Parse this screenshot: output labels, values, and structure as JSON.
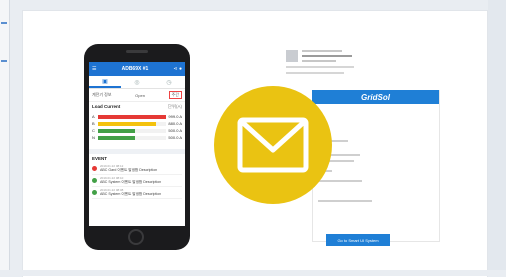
{
  "app": {
    "title": "ADB69X #1",
    "filter_left": "계전기 정보",
    "filter_mid": "Open",
    "filter_right": "주간",
    "load_current_label": "Load Current",
    "load_current_unit": "단위(A)",
    "phases": [
      {
        "label": "A",
        "value": "999.0 A",
        "pct": 1.0,
        "color": "#e53935"
      },
      {
        "label": "B",
        "value": "880.0 A",
        "pct": 0.85,
        "color": "#f4c20d"
      },
      {
        "label": "C",
        "value": "500.0 A",
        "pct": 0.55,
        "color": "#43a047"
      },
      {
        "label": "N",
        "value": "500.0 A",
        "pct": 0.55,
        "color": "#43a047"
      }
    ],
    "event_label": "EVENT",
    "events": [
      {
        "time": "2019.01.22 08:12",
        "text": "ABC Gard 이벤트 발생함 Description",
        "color": "#e53935"
      },
      {
        "time": "2019.01.22 08:10",
        "text": "ABC System 이벤트 발생함 Description",
        "color": "#43a047"
      },
      {
        "time": "2019.01.22 08:08",
        "text": "ABC System 이벤트 발생함 Description",
        "color": "#43a047"
      }
    ]
  },
  "email": {
    "brand": "GridSol",
    "cta_label": "Go to Smart UI System"
  },
  "icons": {
    "mail": "envelope-icon",
    "color_mail_bg": "#eac312"
  }
}
